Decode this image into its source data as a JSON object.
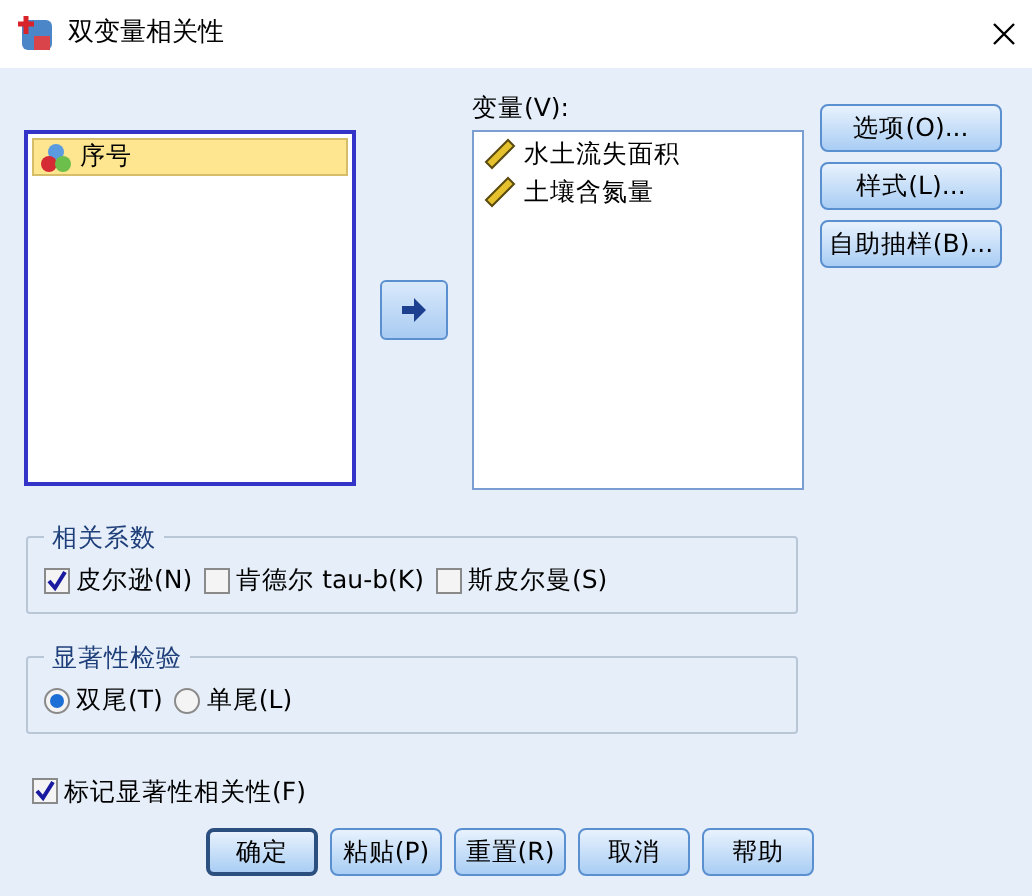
{
  "window": {
    "title": "双变量相关性"
  },
  "source_list": {
    "items": [
      {
        "label": "序号",
        "kind": "nominal",
        "selected": true
      }
    ]
  },
  "variables": {
    "label": "变量(V):",
    "items": [
      {
        "label": "水土流失面积",
        "kind": "scale"
      },
      {
        "label": "土壤含氮量",
        "kind": "scale"
      }
    ]
  },
  "side_buttons": [
    "选项(O)...",
    "样式(L)...",
    "自助抽样(B)..."
  ],
  "correlation": {
    "title": "相关系数",
    "options": [
      {
        "label": "皮尔逊(N)",
        "checked": true
      },
      {
        "label": "肯德尔 tau-b(K)",
        "checked": false
      },
      {
        "label": "斯皮尔曼(S)",
        "checked": false
      }
    ]
  },
  "significance": {
    "title": "显著性检验",
    "options": [
      {
        "label": "双尾(T)",
        "selected": true
      },
      {
        "label": "单尾(L)",
        "selected": false
      }
    ]
  },
  "flag": {
    "label": "标记显著性相关性(F)",
    "checked": true
  },
  "buttons": [
    {
      "label": "确定",
      "default": true
    },
    {
      "label": "粘贴(P)",
      "default": false
    },
    {
      "label": "重置(R)",
      "default": false
    },
    {
      "label": "取消",
      "default": false
    },
    {
      "label": "帮助",
      "default": false
    }
  ]
}
